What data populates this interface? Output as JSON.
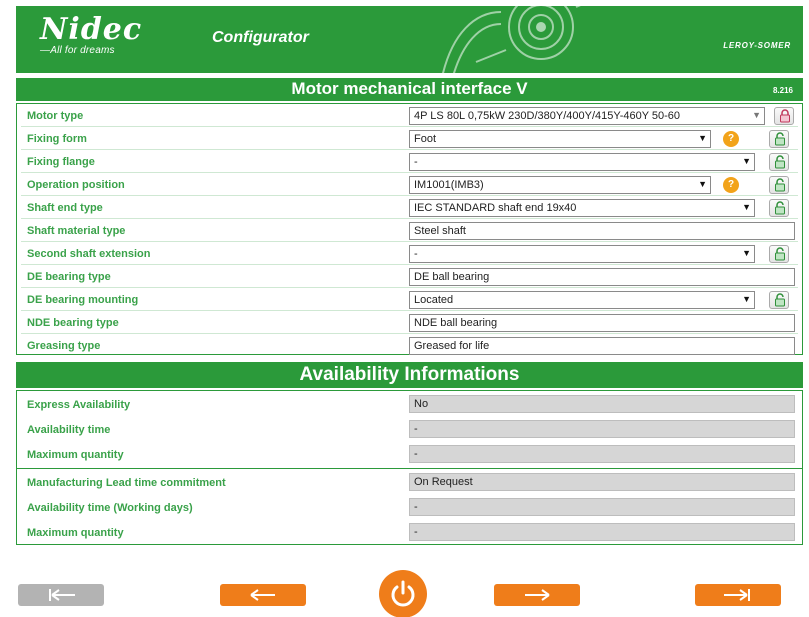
{
  "header": {
    "logo_text": "Nidec",
    "logo_tagline": "—All for dreams",
    "app_name": "Configurator",
    "brand_right": "LEROY-SOMER"
  },
  "title": {
    "text": "Motor mechanical interface V",
    "version": "8.216"
  },
  "form": {
    "rows": [
      {
        "label": "Motor type",
        "value": "4P LS 80L 0,75kW 230D/380Y/400Y/415Y-460Y 50-60",
        "control": "select",
        "help": false,
        "lock": "locked"
      },
      {
        "label": "Fixing form",
        "value": "Foot",
        "control": "select",
        "help": true,
        "lock": "unlocked"
      },
      {
        "label": "Fixing flange",
        "value": "-",
        "control": "select",
        "help": false,
        "lock": "unlocked"
      },
      {
        "label": "Operation position",
        "value": "IM1001(IMB3)",
        "control": "select",
        "help": true,
        "lock": "unlocked"
      },
      {
        "label": "Shaft end type",
        "value": "IEC STANDARD shaft end   19x40",
        "control": "select",
        "help": false,
        "lock": "unlocked"
      },
      {
        "label": "Shaft material type",
        "value": "Steel shaft",
        "control": "text",
        "help": false,
        "lock": null
      },
      {
        "label": "Second shaft extension",
        "value": "-",
        "control": "select",
        "help": false,
        "lock": "unlocked"
      },
      {
        "label": "DE bearing type",
        "value": "DE ball bearing",
        "control": "text",
        "help": false,
        "lock": null
      },
      {
        "label": "DE bearing mounting",
        "value": "Located",
        "control": "select",
        "help": false,
        "lock": "unlocked"
      },
      {
        "label": "NDE bearing type",
        "value": "NDE ball bearing",
        "control": "text",
        "help": false,
        "lock": null
      },
      {
        "label": "Greasing type",
        "value": "Greased for life",
        "control": "text",
        "help": false,
        "lock": null
      }
    ]
  },
  "availability": {
    "title": "Availability Informations",
    "rows": [
      {
        "label": "Express Availability",
        "value": "No"
      },
      {
        "label": "Availability time",
        "value": "-"
      },
      {
        "label": "Maximum quantity",
        "value": "-"
      },
      {
        "label": "Manufacturing Lead time commitment",
        "value": "On Request"
      },
      {
        "label": "Availability time (Working days)",
        "value": "-"
      },
      {
        "label": "Maximum quantity",
        "value": "-"
      }
    ]
  },
  "colors": {
    "brand_green": "#2b9a3a",
    "label_green": "#3aa24a",
    "nav_orange": "#ef7d1a",
    "nav_disabled": "#b3b3b3",
    "help_orange": "#f2a31a"
  },
  "icons": {
    "help": "question-circle-icon",
    "lock_closed": "padlock-closed-icon",
    "lock_open": "padlock-open-icon",
    "first": "arrow-first-icon",
    "prev": "arrow-left-icon",
    "power": "power-icon",
    "next": "arrow-right-icon",
    "last": "arrow-last-icon"
  }
}
